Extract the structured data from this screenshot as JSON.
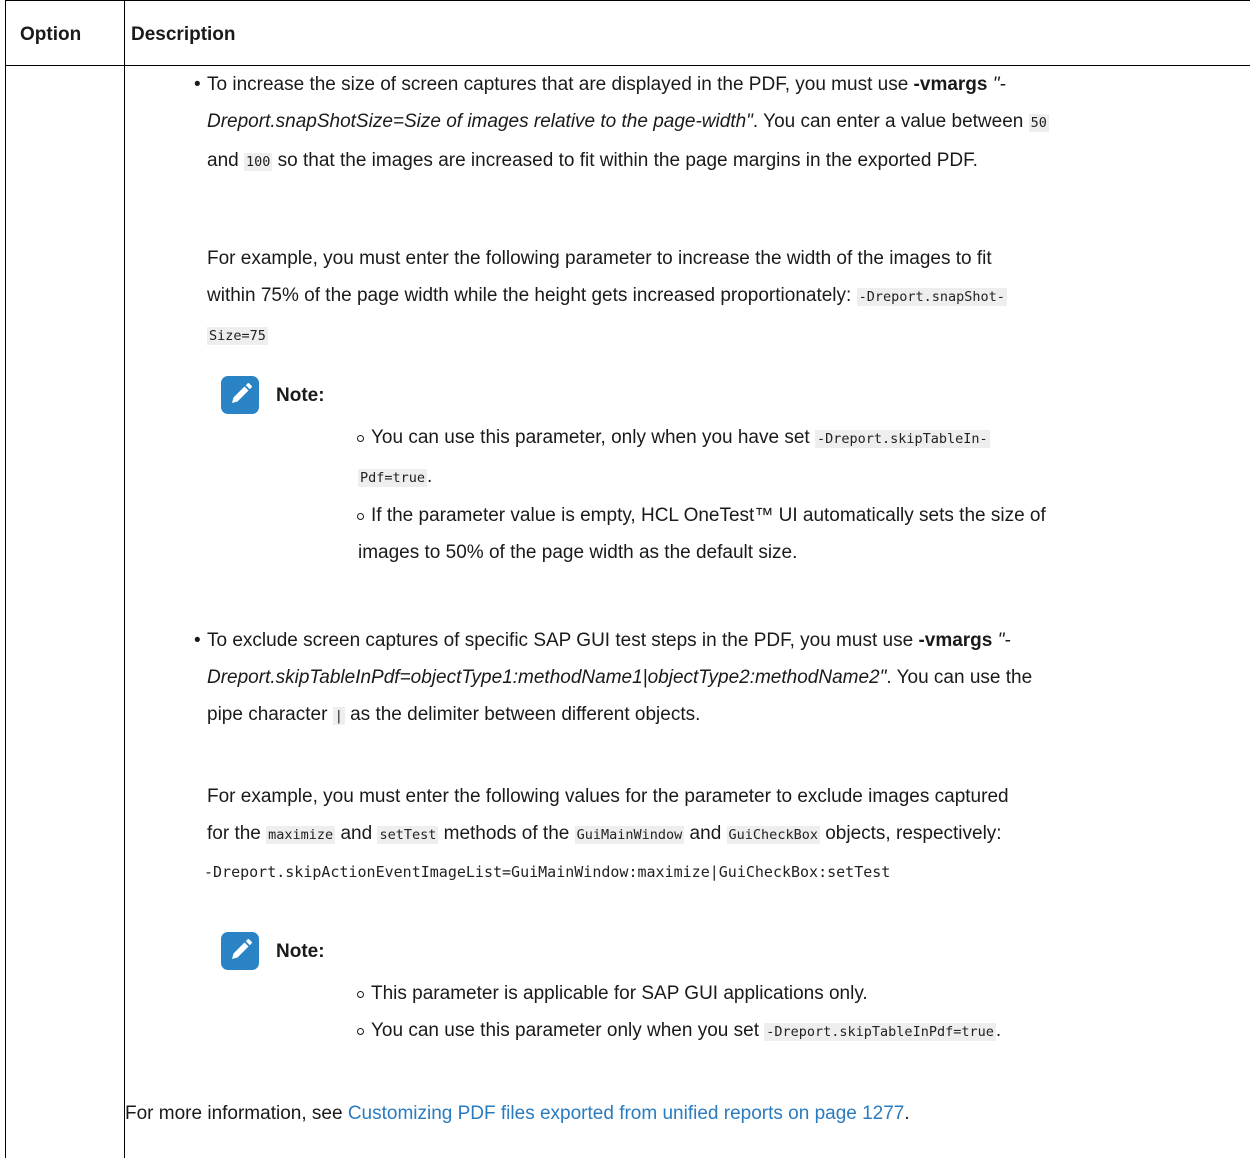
{
  "table": {
    "header_option": "Option",
    "header_description": "Description"
  },
  "bullet1": {
    "lead": "To increase the size of screen captures that are displayed in the PDF, you must use ",
    "flag": "-vmargs",
    "arg_open": " \"-",
    "arg_italic": "Dreport.snapShotSize=Size of images relative to the page-width",
    "arg_close": "\"",
    "after_arg": ". You can enter a value between ",
    "min_value": "50",
    "and_word": "and",
    "max_value": "100",
    "tail": " so that the images are increased to fit within the page margins in the exported PDF.",
    "example_line1": "For example, you must enter the following parameter to increase the width of the images to fit",
    "example_line2": "within 75% of the page width while the height gets increased proportionately: ",
    "example_code_a": "-Dreport.snapShot-",
    "example_code_b": "Size=75"
  },
  "note1": {
    "label": "Note:",
    "item1_text": "You can use this parameter, only when you have set ",
    "item1_code_a": "-Dreport.skipTableIn-",
    "item1_code_b": "Pdf=true",
    "item1_end": ".",
    "item2_line1": "If the parameter value is empty, HCL OneTest™ UI automatically sets the size of",
    "item2_line2": "images to 50% of the page width as the default size."
  },
  "bullet2": {
    "lead": "To exclude screen captures of specific SAP GUI test steps in the PDF, you must use ",
    "flag": "-vmargs",
    "arg_open": " \"-",
    "arg_italic": "Dreport.skipTableInPdf=objectType1:methodName1|objectType2:methodName2",
    "arg_close": "\"",
    "after_arg": ". You can use the",
    "pipe_line_a": "pipe character ",
    "pipe_code": "|",
    "pipe_line_b": " as the delimiter between different objects.",
    "example_line1": "For example, you must enter the following values for the parameter to exclude images captured",
    "ex2_a": "for the ",
    "code_maximize": "maximize",
    "ex2_b": " and ",
    "code_settest": "setTest",
    "ex2_c": " methods of the ",
    "code_mainwindow": "GuiMainWindow",
    "ex2_d": " and ",
    "code_checkbox": "GuiCheckBox",
    "ex2_e": " objects, respectively:",
    "example_code": "-Dreport.skipActionEventImageList=GuiMainWindow:maximize|GuiCheckBox:setTest"
  },
  "note2": {
    "label": "Note:",
    "item1": "This parameter is applicable for SAP GUI applications only.",
    "item2_text": "You can use this parameter only when you set ",
    "item2_code": "-Dreport.skipTableInPdf=true",
    "item2_end": "."
  },
  "footer": {
    "lead": "For more information, see ",
    "link_text": "Customizing PDF files exported from unified reports on page 1277",
    "end": "."
  },
  "colors": {
    "link": "#2a7bbf",
    "note_icon": "#2a83c4"
  },
  "icons": [
    "note-pencil-icon"
  ]
}
